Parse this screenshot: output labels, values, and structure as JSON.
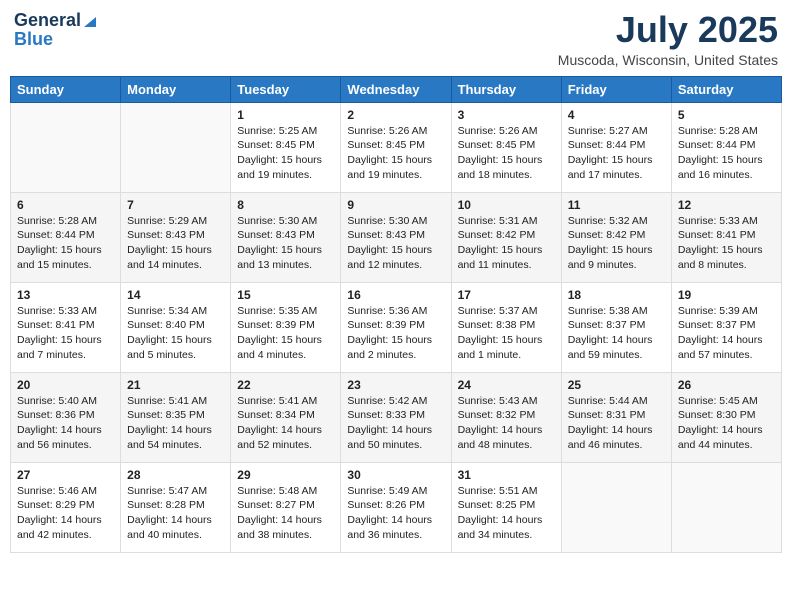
{
  "logo": {
    "general": "General",
    "blue": "Blue"
  },
  "title": {
    "month_year": "July 2025",
    "location": "Muscoda, Wisconsin, United States"
  },
  "days_of_week": [
    "Sunday",
    "Monday",
    "Tuesday",
    "Wednesday",
    "Thursday",
    "Friday",
    "Saturday"
  ],
  "weeks": [
    [
      {
        "day": "",
        "info": ""
      },
      {
        "day": "",
        "info": ""
      },
      {
        "day": "1",
        "info": "Sunrise: 5:25 AM\nSunset: 8:45 PM\nDaylight: 15 hours and 19 minutes."
      },
      {
        "day": "2",
        "info": "Sunrise: 5:26 AM\nSunset: 8:45 PM\nDaylight: 15 hours and 19 minutes."
      },
      {
        "day": "3",
        "info": "Sunrise: 5:26 AM\nSunset: 8:45 PM\nDaylight: 15 hours and 18 minutes."
      },
      {
        "day": "4",
        "info": "Sunrise: 5:27 AM\nSunset: 8:44 PM\nDaylight: 15 hours and 17 minutes."
      },
      {
        "day": "5",
        "info": "Sunrise: 5:28 AM\nSunset: 8:44 PM\nDaylight: 15 hours and 16 minutes."
      }
    ],
    [
      {
        "day": "6",
        "info": "Sunrise: 5:28 AM\nSunset: 8:44 PM\nDaylight: 15 hours and 15 minutes."
      },
      {
        "day": "7",
        "info": "Sunrise: 5:29 AM\nSunset: 8:43 PM\nDaylight: 15 hours and 14 minutes."
      },
      {
        "day": "8",
        "info": "Sunrise: 5:30 AM\nSunset: 8:43 PM\nDaylight: 15 hours and 13 minutes."
      },
      {
        "day": "9",
        "info": "Sunrise: 5:30 AM\nSunset: 8:43 PM\nDaylight: 15 hours and 12 minutes."
      },
      {
        "day": "10",
        "info": "Sunrise: 5:31 AM\nSunset: 8:42 PM\nDaylight: 15 hours and 11 minutes."
      },
      {
        "day": "11",
        "info": "Sunrise: 5:32 AM\nSunset: 8:42 PM\nDaylight: 15 hours and 9 minutes."
      },
      {
        "day": "12",
        "info": "Sunrise: 5:33 AM\nSunset: 8:41 PM\nDaylight: 15 hours and 8 minutes."
      }
    ],
    [
      {
        "day": "13",
        "info": "Sunrise: 5:33 AM\nSunset: 8:41 PM\nDaylight: 15 hours and 7 minutes."
      },
      {
        "day": "14",
        "info": "Sunrise: 5:34 AM\nSunset: 8:40 PM\nDaylight: 15 hours and 5 minutes."
      },
      {
        "day": "15",
        "info": "Sunrise: 5:35 AM\nSunset: 8:39 PM\nDaylight: 15 hours and 4 minutes."
      },
      {
        "day": "16",
        "info": "Sunrise: 5:36 AM\nSunset: 8:39 PM\nDaylight: 15 hours and 2 minutes."
      },
      {
        "day": "17",
        "info": "Sunrise: 5:37 AM\nSunset: 8:38 PM\nDaylight: 15 hours and 1 minute."
      },
      {
        "day": "18",
        "info": "Sunrise: 5:38 AM\nSunset: 8:37 PM\nDaylight: 14 hours and 59 minutes."
      },
      {
        "day": "19",
        "info": "Sunrise: 5:39 AM\nSunset: 8:37 PM\nDaylight: 14 hours and 57 minutes."
      }
    ],
    [
      {
        "day": "20",
        "info": "Sunrise: 5:40 AM\nSunset: 8:36 PM\nDaylight: 14 hours and 56 minutes."
      },
      {
        "day": "21",
        "info": "Sunrise: 5:41 AM\nSunset: 8:35 PM\nDaylight: 14 hours and 54 minutes."
      },
      {
        "day": "22",
        "info": "Sunrise: 5:41 AM\nSunset: 8:34 PM\nDaylight: 14 hours and 52 minutes."
      },
      {
        "day": "23",
        "info": "Sunrise: 5:42 AM\nSunset: 8:33 PM\nDaylight: 14 hours and 50 minutes."
      },
      {
        "day": "24",
        "info": "Sunrise: 5:43 AM\nSunset: 8:32 PM\nDaylight: 14 hours and 48 minutes."
      },
      {
        "day": "25",
        "info": "Sunrise: 5:44 AM\nSunset: 8:31 PM\nDaylight: 14 hours and 46 minutes."
      },
      {
        "day": "26",
        "info": "Sunrise: 5:45 AM\nSunset: 8:30 PM\nDaylight: 14 hours and 44 minutes."
      }
    ],
    [
      {
        "day": "27",
        "info": "Sunrise: 5:46 AM\nSunset: 8:29 PM\nDaylight: 14 hours and 42 minutes."
      },
      {
        "day": "28",
        "info": "Sunrise: 5:47 AM\nSunset: 8:28 PM\nDaylight: 14 hours and 40 minutes."
      },
      {
        "day": "29",
        "info": "Sunrise: 5:48 AM\nSunset: 8:27 PM\nDaylight: 14 hours and 38 minutes."
      },
      {
        "day": "30",
        "info": "Sunrise: 5:49 AM\nSunset: 8:26 PM\nDaylight: 14 hours and 36 minutes."
      },
      {
        "day": "31",
        "info": "Sunrise: 5:51 AM\nSunset: 8:25 PM\nDaylight: 14 hours and 34 minutes."
      },
      {
        "day": "",
        "info": ""
      },
      {
        "day": "",
        "info": ""
      }
    ]
  ]
}
